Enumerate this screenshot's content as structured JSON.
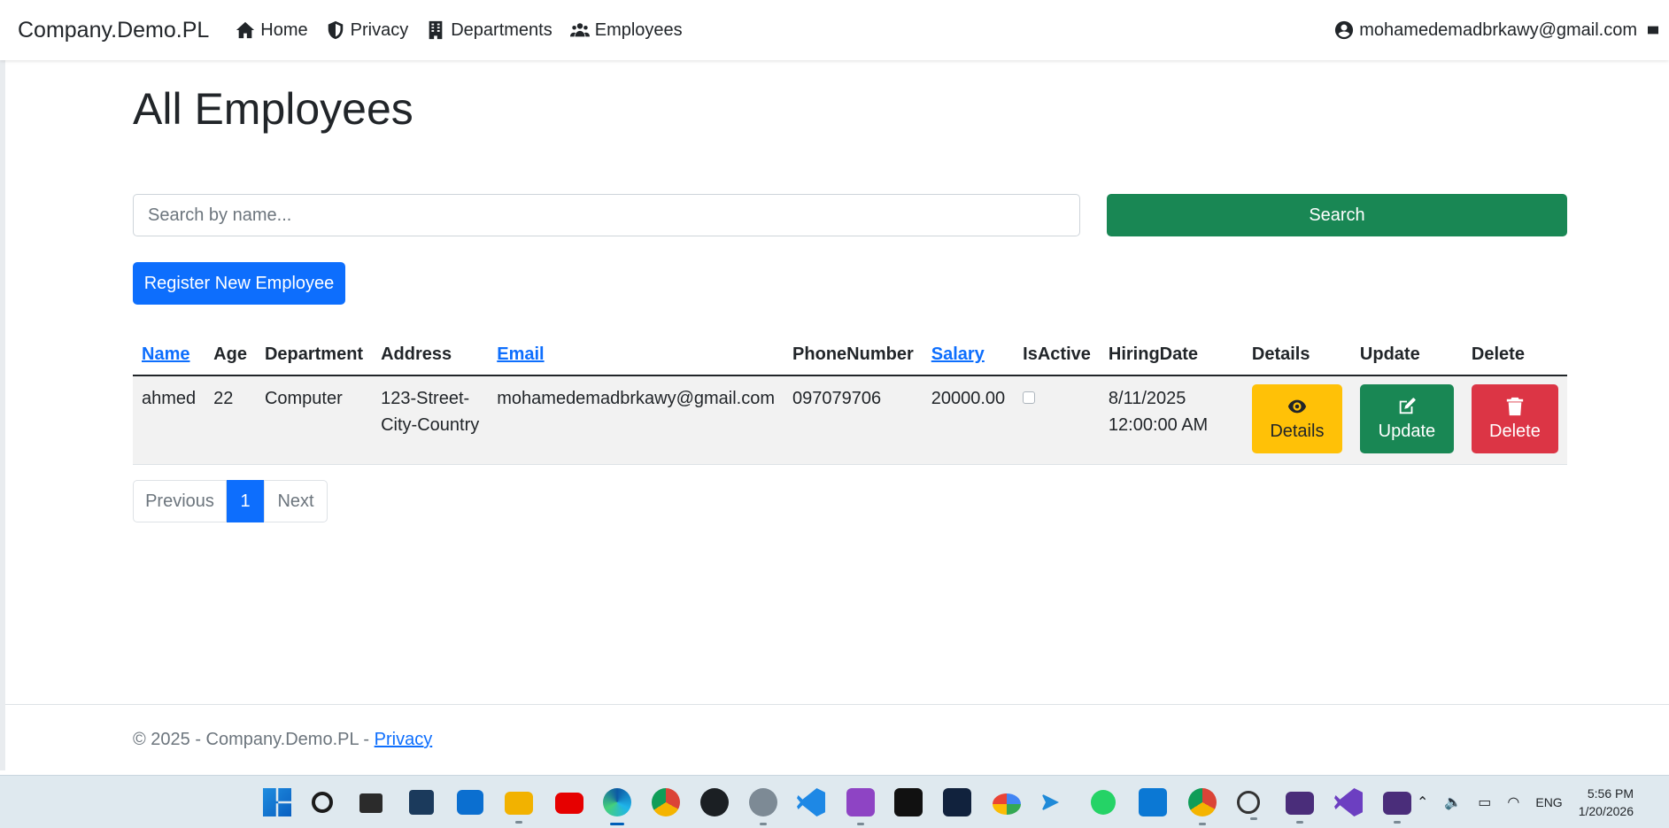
{
  "navbar": {
    "brand": "Company.Demo.PL",
    "links": [
      {
        "label": "Home",
        "icon": "home-icon"
      },
      {
        "label": "Privacy",
        "icon": "shield-icon"
      },
      {
        "label": "Departments",
        "icon": "building-icon"
      },
      {
        "label": "Employees",
        "icon": "users-icon"
      }
    ],
    "user_email": "mohamedemadbrkawy@gmail.com"
  },
  "main": {
    "title": "All Employees",
    "search": {
      "placeholder": "Search by name...",
      "value": "",
      "button_label": "Search"
    },
    "register_label": "Register New Employee",
    "table": {
      "columns": [
        "Name",
        "Age",
        "Department",
        "Address",
        "Email",
        "PhoneNumber",
        "Salary",
        "IsActive",
        "HiringDate",
        "Details",
        "Update",
        "Delete"
      ],
      "rows": [
        {
          "name": "ahmed",
          "age": "22",
          "department": "Computer",
          "address_line1": "123-Street-",
          "address_line2": "City-Country",
          "email": "mohamedemadbrkawy@gmail.com",
          "phone": "097079706",
          "salary": "20000.00",
          "is_active": false,
          "hiring_date_line1": "8/11/2025",
          "hiring_date_line2": "12:00:00 AM",
          "details_label": "Details",
          "update_label": "Update",
          "delete_label": "Delete"
        }
      ]
    },
    "pagination": {
      "previous": "Previous",
      "current": "1",
      "next": "Next"
    }
  },
  "footer": {
    "text": "© 2025 - Company.Demo.PL - ",
    "link": "Privacy"
  },
  "taskbar": {
    "language": "ENG",
    "time": "5:56 PM",
    "date": "1/20/2026"
  },
  "colors": {
    "primary": "#0d6efd",
    "success": "#198754",
    "warning": "#ffc107",
    "danger": "#dc3545"
  }
}
